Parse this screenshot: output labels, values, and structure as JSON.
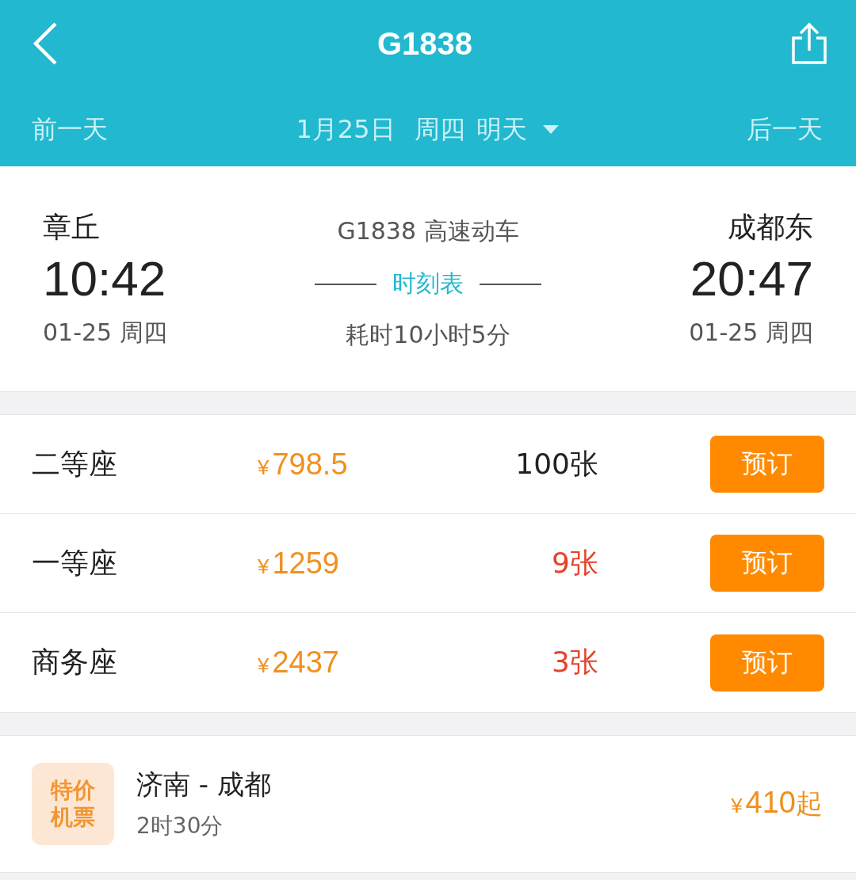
{
  "header": {
    "title": "G1838"
  },
  "date_bar": {
    "prev": "前一天",
    "date": "1月25日",
    "weekday": "周四",
    "relative": "明天",
    "next": "后一天"
  },
  "trip": {
    "depart": {
      "station": "章丘",
      "time": "10:42",
      "date": "01-25 周四"
    },
    "train": "G1838 高速动车",
    "schedule_link": "时刻表",
    "duration": "耗时10小时5分",
    "arrive": {
      "station": "成都东",
      "time": "20:47",
      "date": "01-25 周四"
    }
  },
  "seats": [
    {
      "name": "二等座",
      "currency": "¥",
      "price": "798.5",
      "count": "100张",
      "low": false,
      "button": "预订"
    },
    {
      "name": "一等座",
      "currency": "¥",
      "price": "1259",
      "count": "9张",
      "low": true,
      "button": "预订"
    },
    {
      "name": "商务座",
      "currency": "¥",
      "price": "2437",
      "count": "3张",
      "low": true,
      "button": "预订"
    }
  ],
  "flight": {
    "badge": [
      "特价",
      "机票"
    ],
    "route": "济南 - 成都",
    "duration": "2时30分",
    "currency": "¥",
    "price": "410",
    "suffix": "起"
  }
}
